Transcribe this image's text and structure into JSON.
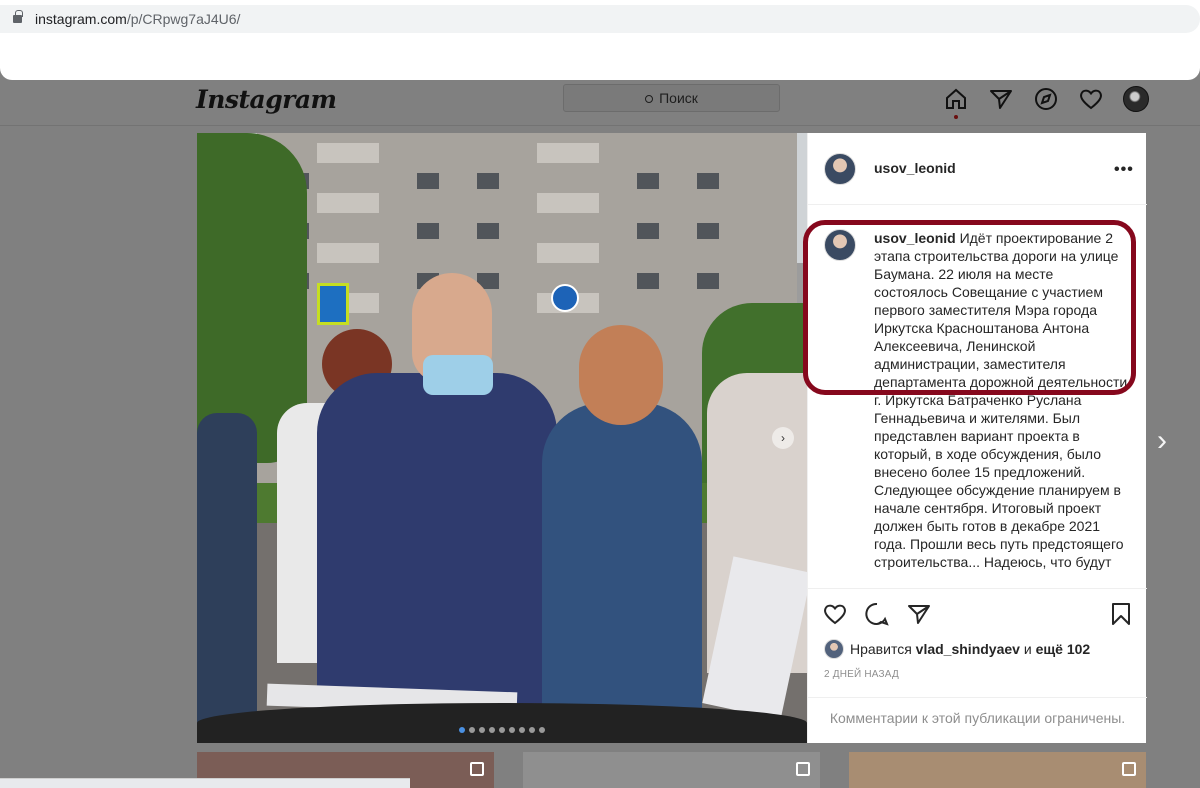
{
  "browser": {
    "url_host": "instagram.com",
    "url_path": "/p/CRpwg7aJ4U6/"
  },
  "nav": {
    "logo": "Instagram",
    "search_placeholder": "Поиск",
    "icons": [
      "home-icon",
      "direct-icon",
      "explore-icon",
      "heart-icon",
      "profile-avatar"
    ]
  },
  "post": {
    "username": "usov_leonid",
    "caption_username": "usov_leonid",
    "caption_text": "Идёт проектирование 2 этапа строительства дороги на улице Баумана. 22 июля на месте состоялось Совещание с участием первого заместителя Мэра города Иркутска Красноштанова Антона Алексеевича, Ленинской администрации, заместителя департамента дорожной деятельности г. Иркутска Батраченко Руслана Геннадьевича и жителями. Был представлен вариант проекта в который, в ходе обсуждения, было внесено более 15 предложений. Следующее обсуждение планируем в начале сентября. Итоговый проект должен быть готов в декабре 2021 года. Прошли весь путь предстоящего строительства... Надеюсь, что будут",
    "likes_prefix": "Нравится",
    "likes_user": "vlad_shindyaev",
    "likes_and": "и",
    "likes_more": "ещё 102",
    "date": "2 ДНЕЙ НАЗАД",
    "comments_disabled": "Комментарии к этой публикации ограничены.",
    "carousel_count": 9,
    "carousel_active": 0
  },
  "colors": {
    "highlight": "#86081d",
    "overlay": "#808080",
    "text": "#262626",
    "muted": "#8e8e8e"
  }
}
